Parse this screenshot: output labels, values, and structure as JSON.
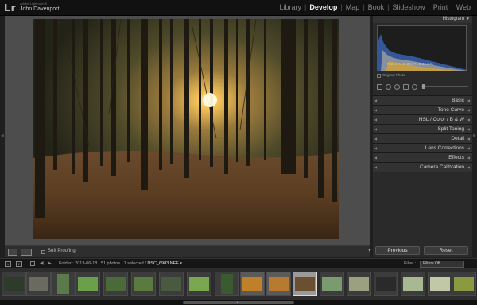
{
  "app": {
    "logo": "Lr",
    "version": "Adobe Lightroom 5",
    "user": "John Davenport"
  },
  "modules": [
    {
      "label": "Library",
      "active": false
    },
    {
      "label": "Develop",
      "active": true
    },
    {
      "label": "Map",
      "active": false
    },
    {
      "label": "Book",
      "active": false
    },
    {
      "label": "Slideshow",
      "active": false
    },
    {
      "label": "Print",
      "active": false
    },
    {
      "label": "Web",
      "active": false
    }
  ],
  "toolbar": {
    "soft_proofing": "Soft Proofing"
  },
  "histogram": {
    "title": "Histogram",
    "readout": "R  24.6  %   G  20.9  %   B  26.3  %",
    "original_photo": "Original Photo"
  },
  "panels": {
    "basic": "Basic",
    "tone_curve": "Tone Curve",
    "hsl": "HSL  /  Color  /  B & W",
    "split_toning": "Split Toning",
    "detail": "Detail",
    "lens_corrections": "Lens Corrections",
    "effects": "Effects",
    "camera_calibration": "Camera Calibration"
  },
  "buttons": {
    "previous": "Previous",
    "reset": "Reset"
  },
  "filmstrip": {
    "box1": "1",
    "box2": "2",
    "folder": "Folder : 2013-06-18",
    "count": "51 photos / 1 selected /",
    "filename": "DSC_6983.NEF",
    "filter_label": "Filter :",
    "filter_value": "Filters Off"
  },
  "colors": {
    "accent": "#f0f0f0",
    "panel": "#2a2a2a",
    "selected_thumb": "#9a9a9a"
  }
}
